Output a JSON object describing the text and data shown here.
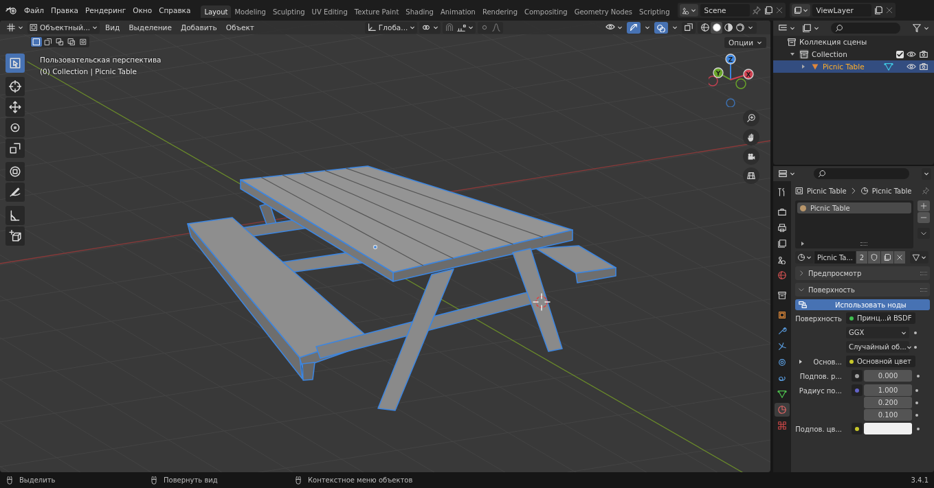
{
  "menu_bar": {
    "menus": [
      "Файл",
      "Правка",
      "Рендеринг",
      "Окно",
      "Справка"
    ]
  },
  "workspaces": [
    {
      "label": "Layout",
      "selected": true
    },
    {
      "label": "Modeling",
      "selected": false
    },
    {
      "label": "Sculpting",
      "selected": false
    },
    {
      "label": "UV Editing",
      "selected": false
    },
    {
      "label": "Texture Paint",
      "selected": false
    },
    {
      "label": "Shading",
      "selected": false
    },
    {
      "label": "Animation",
      "selected": false
    },
    {
      "label": "Rendering",
      "selected": false
    },
    {
      "label": "Compositing",
      "selected": false
    },
    {
      "label": "Geometry Nodes",
      "selected": false
    },
    {
      "label": "Scripting",
      "selected": false
    }
  ],
  "scene": {
    "name": "Scene"
  },
  "view_layer": {
    "name": "ViewLayer"
  },
  "viewport": {
    "mode": "Объектный...",
    "menus": [
      "Вид",
      "Выделение",
      "Добавить",
      "Объект"
    ],
    "orientation": "Глоба...",
    "toggles": [
      {
        "kind": "gizmo",
        "on": true
      },
      {
        "kind": "overlay",
        "on": true
      },
      {
        "kind": "xray",
        "on": false
      }
    ],
    "shading_modes": [
      {
        "kind": "wireframe",
        "selected": false
      },
      {
        "kind": "solid",
        "selected": true
      },
      {
        "kind": "material",
        "selected": false
      },
      {
        "kind": "rendered",
        "selected": false
      }
    ],
    "select_modes": [
      {
        "kind": "set",
        "selected": true
      },
      {
        "kind": "extend",
        "selected": false
      },
      {
        "kind": "subtract",
        "selected": false
      },
      {
        "kind": "invert",
        "selected": false
      },
      {
        "kind": "intersect",
        "selected": false
      }
    ],
    "options": "Опции",
    "view_name": "Пользовательская перспектива",
    "context": "(0) Collection | Picnic Table",
    "tools": [
      {
        "kind": "select",
        "selected": true
      },
      {
        "kind": "cursor",
        "selected": false
      },
      {
        "kind": "move",
        "selected": false
      },
      {
        "kind": "rotate",
        "selected": false
      },
      {
        "kind": "scale",
        "selected": false
      },
      {
        "kind": "transform",
        "selected": false
      },
      {
        "kind": "annotate",
        "selected": false
      },
      {
        "kind": "measure",
        "selected": false
      },
      {
        "kind": "add_cube",
        "selected": false
      }
    ],
    "gizmo_axes": [
      "Z",
      "Y",
      "X"
    ]
  },
  "outliner": {
    "root": "Коллекция сцены",
    "items": [
      {
        "label": "Collection",
        "expanded": true,
        "checked": true,
        "selected": false,
        "children": [
          {
            "label": "Picnic Table",
            "expanded": false,
            "selected": true
          }
        ]
      }
    ]
  },
  "properties": {
    "tabs": [
      {
        "kind": "tool",
        "selected": false
      },
      {
        "kind": "render",
        "selected": false
      },
      {
        "kind": "output",
        "selected": false
      },
      {
        "kind": "view_layer",
        "selected": false
      },
      {
        "kind": "scene",
        "selected": false
      },
      {
        "kind": "world",
        "selected": false
      },
      {
        "kind": "collection",
        "selected": false
      },
      {
        "kind": "object",
        "selected": false
      },
      {
        "kind": "modifiers",
        "selected": false
      },
      {
        "kind": "particles",
        "selected": false
      },
      {
        "kind": "physics",
        "selected": false
      },
      {
        "kind": "constraints",
        "selected": false
      },
      {
        "kind": "data",
        "selected": false
      },
      {
        "kind": "material",
        "selected": true
      },
      {
        "kind": "texture",
        "selected": false
      }
    ],
    "breadcrumb": [
      "Picnic Table",
      "Picnic Table"
    ],
    "slots": [
      {
        "label": "Picnic Table",
        "selected": true
      }
    ],
    "material": {
      "name": "Picnic Ta...",
      "users": "2"
    },
    "panels": [
      {
        "title": "Предпросмотр",
        "expanded": false
      },
      {
        "title": "Поверхность",
        "expanded": true
      }
    ],
    "use_nodes": "Использовать ноды",
    "rows": [
      {
        "kind": "link",
        "label": "Поверхность",
        "value": "Принц...й BSDF",
        "color": "#3fbf4f"
      },
      {
        "kind": "dropdown",
        "value": "GGX"
      },
      {
        "kind": "dropdown",
        "value": "Случайный об..."
      },
      {
        "kind": "link",
        "label": "Основ...",
        "value": "Основной цвет",
        "color": "#c7c729",
        "expanded": false
      },
      {
        "kind": "number",
        "label": "Подпов. р...",
        "value": "0.000",
        "color": "#a1a1a1"
      },
      {
        "kind": "vector",
        "label": "Радиус по...",
        "values": [
          "1.000",
          "0.200",
          "0.100"
        ],
        "color": "#6363c7"
      },
      {
        "kind": "color",
        "label": "Подпов. цв...",
        "color": "#c7c729"
      }
    ]
  },
  "status_bar": {
    "hints": [
      "Выделить",
      "Повернуть вид",
      "Контекстное меню объектов"
    ],
    "version": "3.4.1"
  }
}
